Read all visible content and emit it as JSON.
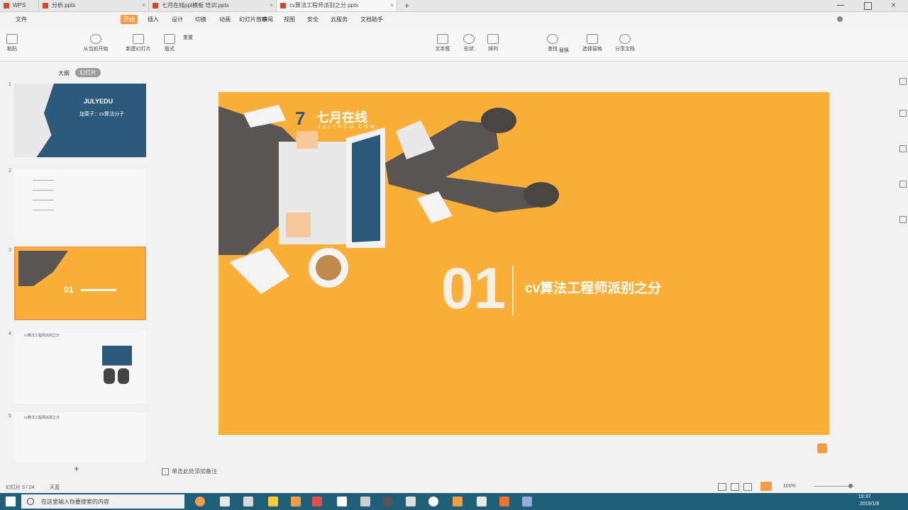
{
  "tabs": [
    {
      "label": "WPS"
    },
    {
      "label": "分析.pptx"
    },
    {
      "label": "七月在线ppt模板 培训.pptx"
    },
    {
      "label": "cv算法工程师派别之分.pptx"
    }
  ],
  "menu": [
    "文件",
    "开始",
    "插入",
    "设计",
    "切换",
    "动画",
    "幻灯片放映",
    "审阅",
    "视图",
    "安全",
    "云服务",
    "文档助手"
  ],
  "menu_active": "开始",
  "ribbon": [
    "粘贴",
    "从当前开始",
    "新建幻灯片",
    "版式",
    "重置",
    "文本框",
    "形状",
    "排列",
    "查找",
    "替换",
    "选择窗格",
    "分享文档"
  ],
  "panel": {
    "tab_outline": "大纲",
    "tab_slides": "幻灯片"
  },
  "thumbs": [
    {
      "num": "1",
      "title": "JULYEDU",
      "subtitle": "加菜子：cv算法分子"
    },
    {
      "num": "2",
      "title": ""
    },
    {
      "num": "3",
      "title": "01"
    },
    {
      "num": "4",
      "title": "cv算法工程师派别之分"
    },
    {
      "num": "5",
      "title": "cv算法工程师派别之分"
    }
  ],
  "slide": {
    "logo_text": "七月在线",
    "logo_sub": "JULYEDU.COM",
    "number": "01",
    "title": "cv算法工程师派别之分"
  },
  "notes_placeholder": "单击此处添加备注",
  "status": {
    "slide_count": "幻灯片 3 / 24",
    "theme": "天蓝",
    "zoom": "100%"
  },
  "taskbar": {
    "search_placeholder": "在这里输入你要搜索的内容",
    "time": "19:37",
    "date": "2019/1/8"
  },
  "colors": {
    "slide_bg": "#fcaf38",
    "accent": "#f39c45",
    "taskbar": "#1f5f78",
    "thumb_dark": "#2d5a7a"
  }
}
